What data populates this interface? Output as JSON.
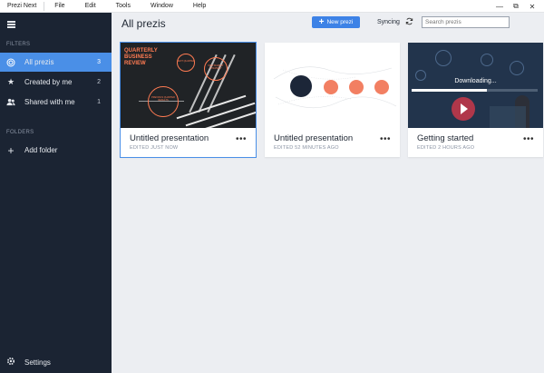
{
  "app": {
    "name": "Prezi Next",
    "menu": [
      "File",
      "Edit",
      "Tools",
      "Window",
      "Help"
    ],
    "window_controls": [
      "—",
      "⧉",
      "✕"
    ]
  },
  "sidebar": {
    "filters_title": "FILTERS",
    "items": [
      {
        "label": "All prezis",
        "count": "3",
        "icon": "target-icon",
        "active": true
      },
      {
        "label": "Created by me",
        "count": "2",
        "icon": "star-icon",
        "active": false
      },
      {
        "label": "Shared with me",
        "count": "1",
        "icon": "people-icon",
        "active": false
      }
    ],
    "folders_title": "FOLDERS",
    "add_folder": "Add folder",
    "settings": "Settings"
  },
  "header": {
    "title": "All prezis",
    "new_button": "New prezi",
    "sync_status": "Syncing",
    "search_placeholder": "Search prezis"
  },
  "cards": [
    {
      "title": "Untitled presentation",
      "subtitle": "EDITED JUST NOW",
      "thumb_heading": [
        "QUARTERLY",
        "BUSINESS",
        "REVIEW"
      ],
      "thumb_rings": [
        "NEXT QUARTER",
        "NEW MARKET STRATEGY",
        "PREVIOUS QUARTER RESULTS"
      ]
    },
    {
      "title": "Untitled presentation",
      "subtitle": "EDITED 52 MINUTES AGO"
    },
    {
      "title": "Getting started",
      "subtitle": "EDITED 2 HOURS AGO",
      "download_label": "Downloading...",
      "download_progress": 0.6
    }
  ],
  "colors": {
    "accent": "#4a8fe7",
    "sidebar_bg": "#1b2433",
    "orange": "#ff7b52",
    "navy": "#1c2638"
  }
}
